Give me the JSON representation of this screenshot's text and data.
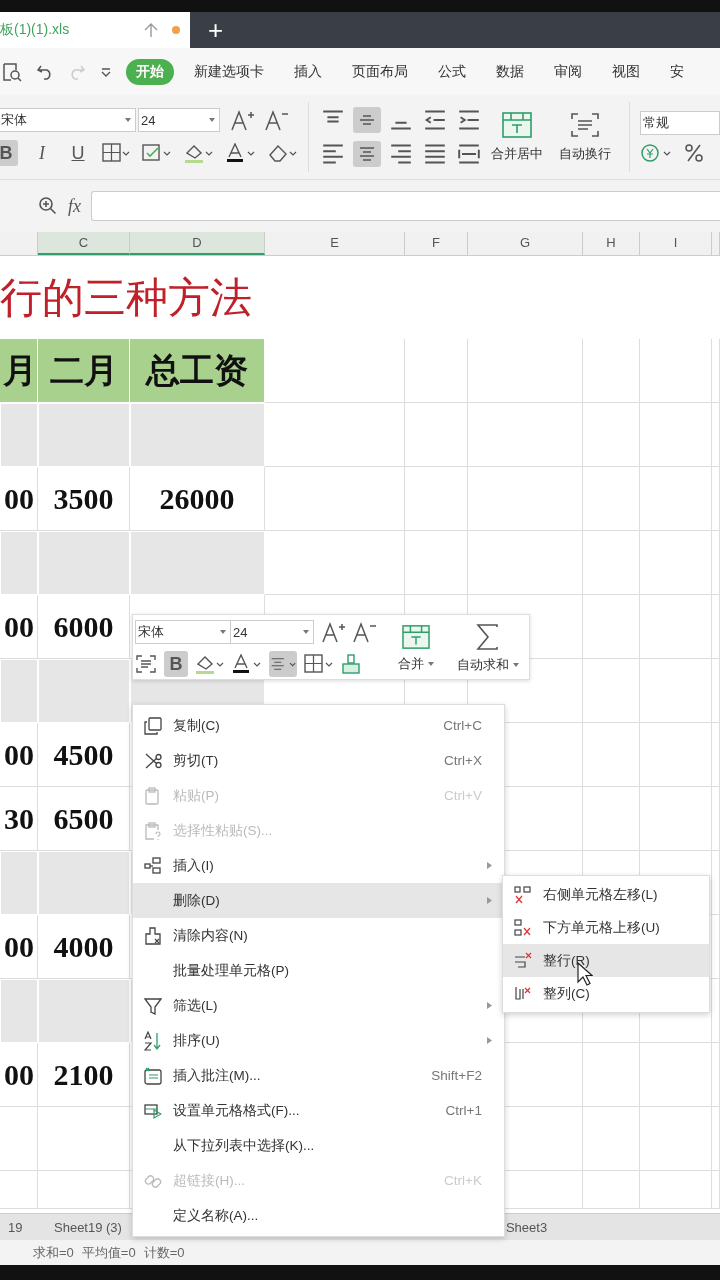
{
  "file_tab": {
    "title": "板(1)(1).xls",
    "modified": true,
    "new_tab": "+"
  },
  "menu_tabs": [
    {
      "label": "开始",
      "selected": true
    },
    {
      "label": "新建选项卡",
      "selected": false
    },
    {
      "label": "插入",
      "selected": false
    },
    {
      "label": "页面布局",
      "selected": false
    },
    {
      "label": "公式",
      "selected": false
    },
    {
      "label": "数据",
      "selected": false
    },
    {
      "label": "审阅",
      "selected": false
    },
    {
      "label": "视图",
      "selected": false
    },
    {
      "label": "安",
      "selected": false
    }
  ],
  "ribbon": {
    "font": "宋体",
    "size": "24",
    "format_buttons": [
      {
        "label": "B",
        "selected": true
      },
      {
        "label": "I",
        "selected": false
      },
      {
        "label": "U",
        "selected": false
      }
    ],
    "align_center": true,
    "merge_label": "合并居中",
    "wrap_label": "自动换行",
    "number_format": "常规"
  },
  "formula_bar": {
    "fx": "fx"
  },
  "columns": [
    "",
    "C",
    "D",
    "E",
    "F",
    "G",
    "H",
    "I"
  ],
  "title": "行的三种方法",
  "header": [
    "月",
    "二月",
    "总工资"
  ],
  "rows": [
    {
      "kind": "shaded"
    },
    {
      "kind": "data",
      "cells": [
        "00",
        "3500",
        "26000"
      ]
    },
    {
      "kind": "shaded"
    },
    {
      "kind": "data",
      "cells": [
        "00",
        "6000"
      ]
    },
    {
      "kind": "shaded"
    },
    {
      "kind": "data",
      "cells": [
        "00",
        "4500"
      ]
    },
    {
      "kind": "data",
      "cells": [
        "30",
        "6500"
      ]
    },
    {
      "kind": "shaded"
    },
    {
      "kind": "data",
      "cells": [
        "00",
        "4000"
      ]
    },
    {
      "kind": "shaded"
    },
    {
      "kind": "data",
      "cells": [
        "00",
        "2100"
      ]
    },
    {
      "kind": "empty"
    },
    {
      "kind": "empty"
    }
  ],
  "mini_toolbar": {
    "font": "宋体",
    "size": "24",
    "bold": {
      "label": "B",
      "selected": true
    },
    "align_center": true,
    "merge_label": "合并",
    "sum_label": "自动求和"
  },
  "context_menu": [
    {
      "label": "复制(C)",
      "shortcut": "Ctrl+C",
      "disabled": false,
      "submenu": false,
      "selected": false
    },
    {
      "label": "剪切(T)",
      "shortcut": "Ctrl+X",
      "disabled": false,
      "submenu": false,
      "selected": false
    },
    {
      "label": "粘贴(P)",
      "shortcut": "Ctrl+V",
      "disabled": true,
      "submenu": false,
      "selected": false
    },
    {
      "label": "选择性粘贴(S)...",
      "disabled": true,
      "submenu": false,
      "selected": false
    },
    {
      "label": "插入(I)",
      "disabled": false,
      "submenu": true,
      "selected": false
    },
    {
      "label": "删除(D)",
      "disabled": false,
      "submenu": true,
      "selected": true
    },
    {
      "label": "清除内容(N)",
      "disabled": false,
      "submenu": false,
      "selected": false
    },
    {
      "label": "批量处理单元格(P)",
      "disabled": false,
      "submenu": false,
      "selected": false
    },
    {
      "label": "筛选(L)",
      "disabled": false,
      "submenu": true,
      "selected": false
    },
    {
      "label": "排序(U)",
      "disabled": false,
      "submenu": true,
      "selected": false
    },
    {
      "label": "插入批注(M)...",
      "shortcut": "Shift+F2",
      "disabled": false,
      "submenu": false,
      "selected": false
    },
    {
      "label": "设置单元格格式(F)...",
      "shortcut": "Ctrl+1",
      "disabled": false,
      "submenu": false,
      "selected": false
    },
    {
      "label": "从下拉列表中选择(K)...",
      "disabled": false,
      "submenu": false,
      "selected": false
    },
    {
      "label": "超链接(H)...",
      "shortcut": "Ctrl+K",
      "disabled": true,
      "submenu": false,
      "selected": false
    },
    {
      "label": "定义名称(A)...",
      "disabled": false,
      "submenu": false,
      "selected": false
    }
  ],
  "submenu": [
    {
      "label": "右侧单元格左移(L)",
      "selected": false
    },
    {
      "label": "下方单元格上移(U)",
      "selected": false
    },
    {
      "label": "整行(R)",
      "selected": true
    },
    {
      "label": "整列(C)",
      "selected": false
    }
  ],
  "sheet_tabs": [
    "19",
    "Sheet19 (3)",
    "Sheet3"
  ],
  "status_bar": [
    "求和=0",
    "平均值=0",
    "计数=0"
  ]
}
